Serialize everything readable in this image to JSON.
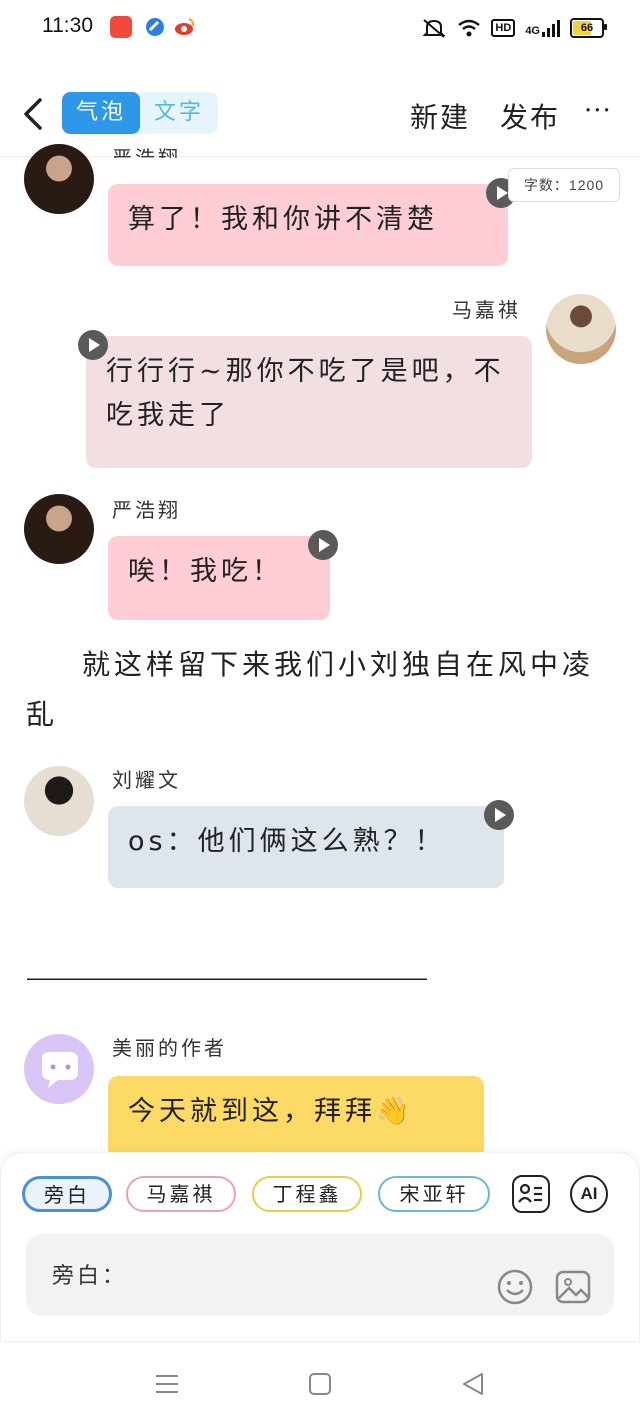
{
  "status_bar": {
    "time": "11:30",
    "battery": "66",
    "network": "4G",
    "hd": "HD"
  },
  "header": {
    "segments": [
      "气泡",
      "文字"
    ],
    "new_label": "新建",
    "publish_label": "发布",
    "more_label": "···"
  },
  "word_count": "字数：1200",
  "messages": [
    {
      "speaker": "严浩翔",
      "text": "算了！我和你讲不清楚",
      "side": "left",
      "color": "#ffcdd6"
    },
    {
      "speaker": "马嘉祺",
      "text": "行行行~那你不吃了是吧，不吃我走了",
      "side": "right",
      "color": "#f2dfe2"
    },
    {
      "speaker": "严浩翔",
      "text": "唉！我吃！",
      "side": "left",
      "color": "#ffcdd6"
    }
  ],
  "narration": "就这样留下来我们小刘独自在风中凌乱",
  "message_liu": {
    "speaker": "刘耀文",
    "text": "os：他们俩这么熟？！",
    "color": "#dfe5ec"
  },
  "divider": "————————————————————",
  "author_message": {
    "speaker": "美丽的作者",
    "text": "今天就到这，拜拜👋",
    "color": "#fdd966"
  },
  "input_panel": {
    "chips": [
      {
        "label": "旁白",
        "color": "#4a90d9"
      },
      {
        "label": "马嘉祺",
        "color": "#e8a5ae"
      },
      {
        "label": "丁程鑫",
        "color": "#e8cc4a"
      },
      {
        "label": "宋亚轩",
        "color": "#6bb6e0"
      }
    ],
    "ai_label": "AI",
    "input_prefix": "旁白："
  }
}
